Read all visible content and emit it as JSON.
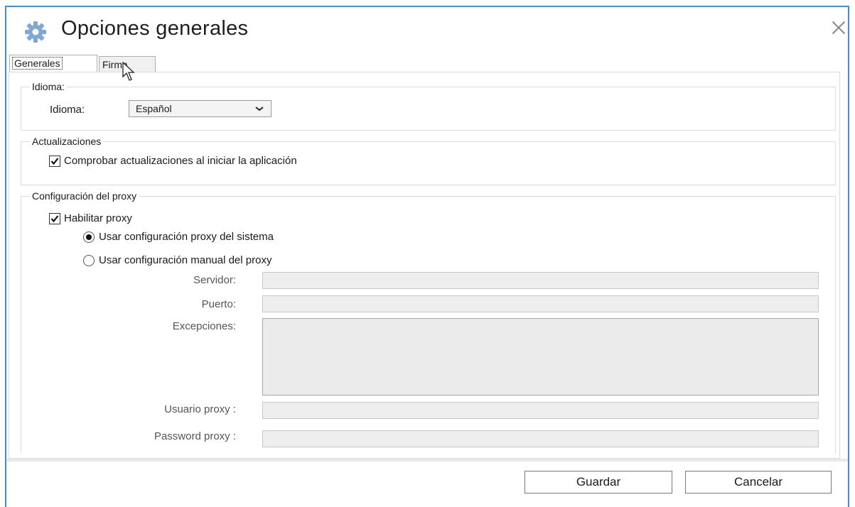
{
  "window": {
    "title": "Opciones generales",
    "icon": "gear-icon",
    "accent_color": "#3d8fd6"
  },
  "tabs": [
    {
      "label": "Generales",
      "active": true
    },
    {
      "label": "Firma",
      "active": false
    }
  ],
  "idioma_group": {
    "title": "Idioma:",
    "label": "Idioma:",
    "selected": "Español"
  },
  "updates_group": {
    "title": "Actualizaciones",
    "check_updates_label": "Comprobar actualizaciones al iniciar la aplicación",
    "check_updates_checked": true
  },
  "proxy_group": {
    "title": "Configuración del proxy",
    "enable_label": "Habilitar proxy",
    "enable_checked": true,
    "system_label": "Usar configuración proxy del sistema",
    "system_selected": true,
    "manual_label": "Usar configuración manual del proxy",
    "manual_selected": false,
    "server_label": "Servidor:",
    "port_label": "Puerto:",
    "exceptions_label": "Excepciones:",
    "user_label": "Usuario proxy :",
    "password_label": "Password proxy :"
  },
  "footer": {
    "save_label": "Guardar",
    "cancel_label": "Cancelar"
  }
}
